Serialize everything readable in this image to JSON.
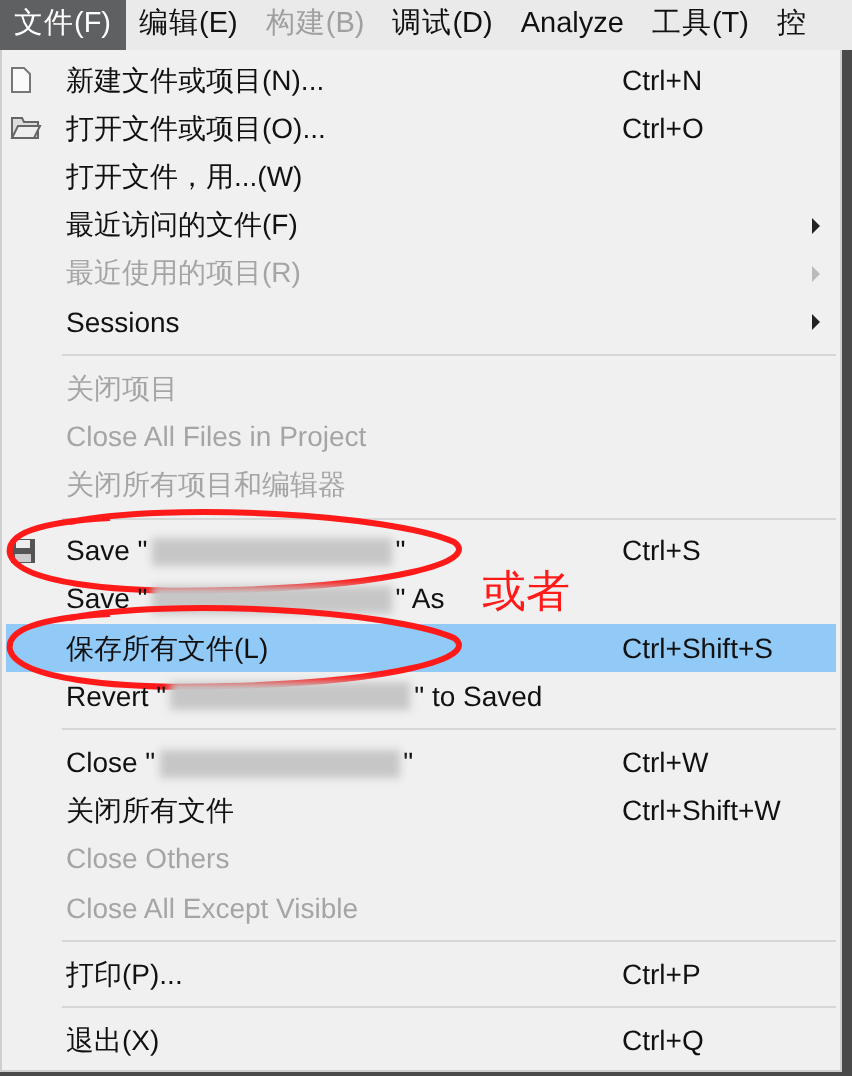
{
  "menu_bar": [
    {
      "label": "文件(F)",
      "selected": true,
      "disabled": false
    },
    {
      "label": "编辑(E)",
      "selected": false,
      "disabled": false
    },
    {
      "label": "构建(B)",
      "selected": false,
      "disabled": true
    },
    {
      "label": "调试(D)",
      "selected": false,
      "disabled": false
    },
    {
      "label": "Analyze",
      "selected": false,
      "disabled": false
    },
    {
      "label": "工具(T)",
      "selected": false,
      "disabled": false
    },
    {
      "label": "控",
      "selected": false,
      "disabled": false
    }
  ],
  "file_menu": [
    {
      "kind": "item",
      "label": "新建文件或项目(N)...",
      "shortcut": "Ctrl+N",
      "disabled": false,
      "selected": false,
      "circled": false
    },
    {
      "kind": "item",
      "label": "打开文件或项目(O)...",
      "shortcut": "Ctrl+O",
      "disabled": false,
      "selected": false,
      "circled": false
    },
    {
      "kind": "item",
      "label": "打开文件，用...(W)",
      "disabled": false,
      "selected": false,
      "circled": false
    },
    {
      "kind": "submenu",
      "label": "最近访问的文件(F)",
      "disabled": false,
      "selected": false,
      "circled": false
    },
    {
      "kind": "submenu",
      "label": "最近使用的项目(R)",
      "disabled": true,
      "selected": false,
      "circled": false
    },
    {
      "kind": "submenu",
      "label": "Sessions",
      "disabled": false,
      "selected": false,
      "circled": false
    },
    {
      "kind": "separator"
    },
    {
      "kind": "item",
      "label": "关闭项目",
      "disabled": true,
      "selected": false,
      "circled": false
    },
    {
      "kind": "item",
      "label": "Close All Files in Project",
      "disabled": true,
      "selected": false,
      "circled": false
    },
    {
      "kind": "item",
      "label": "关闭所有项目和编辑器",
      "disabled": true,
      "selected": false,
      "circled": false
    },
    {
      "kind": "separator"
    },
    {
      "kind": "item",
      "label": "Save \"",
      "label_end": "\"",
      "shortcut": "Ctrl+S",
      "disabled": false,
      "selected": false,
      "circled": true
    },
    {
      "kind": "item",
      "label": "Save \"",
      "label_end": "\" As",
      "disabled": false,
      "selected": false,
      "circled": false
    },
    {
      "kind": "item",
      "label": "保存所有文件(L)",
      "shortcut": "Ctrl+Shift+S",
      "disabled": false,
      "selected": true,
      "circled": true
    },
    {
      "kind": "item",
      "label": "Revert \"",
      "label_end": "\" to Saved",
      "disabled": false,
      "selected": false,
      "circled": false
    },
    {
      "kind": "separator"
    },
    {
      "kind": "item",
      "label": "Close \"",
      "label_end": "\"",
      "shortcut": "Ctrl+W",
      "disabled": false,
      "selected": false,
      "circled": false
    },
    {
      "kind": "item",
      "label": "关闭所有文件",
      "shortcut": "Ctrl+Shift+W",
      "disabled": false,
      "selected": false,
      "circled": false
    },
    {
      "kind": "item",
      "label": "Close Others",
      "disabled": true,
      "selected": false,
      "circled": false
    },
    {
      "kind": "item",
      "label": "Close All Except Visible",
      "disabled": true,
      "selected": false,
      "circled": false
    },
    {
      "kind": "separator"
    },
    {
      "kind": "item",
      "label": "打印(P)...",
      "shortcut": "Ctrl+P",
      "disabled": false,
      "selected": false,
      "circled": false
    },
    {
      "kind": "separator"
    },
    {
      "kind": "item",
      "label": "退出(X)",
      "shortcut": "Ctrl+Q",
      "disabled": false,
      "selected": false,
      "circled": false
    }
  ],
  "annotation": {
    "text": "或者"
  }
}
